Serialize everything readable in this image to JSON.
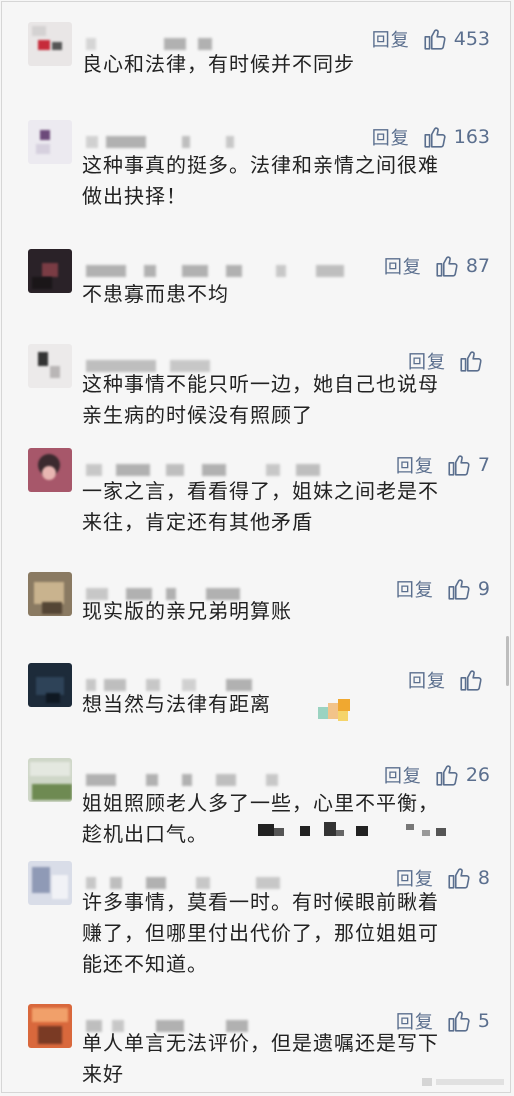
{
  "reply_label": "回复",
  "colors": {
    "link": "#5b6f8e",
    "text": "#222222",
    "background": "#f6f6f6"
  },
  "comments": [
    {
      "lines": [
        "良心和法律，有时候并不同步"
      ],
      "likes": "453"
    },
    {
      "lines": [
        "这种事真的挺多。法律和亲情之间很难",
        "做出抉择！"
      ],
      "likes": "163"
    },
    {
      "lines": [
        "不患寡而患不均"
      ],
      "likes": "87"
    },
    {
      "lines": [
        "这种事情不能只听一边，她自己也说母",
        "亲生病的时候没有照顾了"
      ],
      "likes": ""
    },
    {
      "lines": [
        "一家之言，看看得了，姐妹之间老是不",
        "来往，肯定还有其他矛盾"
      ],
      "likes": "7"
    },
    {
      "lines": [
        "现实版的亲兄弟明算账"
      ],
      "likes": "9"
    },
    {
      "lines": [
        "想当然与法律有距离"
      ],
      "likes": ""
    },
    {
      "lines": [
        " 姐姐照顾老人多了一些，心里不平衡，",
        "趁机出口气。"
      ],
      "likes": "26"
    },
    {
      "lines": [
        "许多事情，莫看一时。有时候眼前瞅着",
        "赚了，但哪里付出代价了，那位姐姐可",
        "能还不知道。"
      ],
      "likes": "8"
    },
    {
      "lines": [
        "单人单言无法评价，但是遗嘱还是写下",
        "来好"
      ],
      "likes": "5"
    }
  ]
}
